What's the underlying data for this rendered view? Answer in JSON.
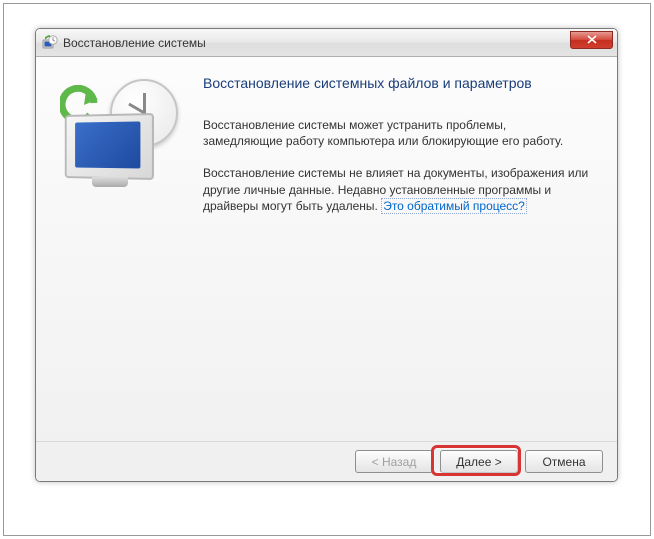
{
  "window": {
    "title": "Восстановление системы"
  },
  "page": {
    "heading": "Восстановление системных файлов и параметров",
    "para1": "Восстановление системы может устранить проблемы, замедляющие работу компьютера или блокирующие его работу.",
    "para2_before": "Восстановление системы не влияет на документы, изображения или другие личные данные. Недавно установленные программы и драйверы могут быть удалены. ",
    "para2_link": "Это обратимый процесс?"
  },
  "buttons": {
    "back": "< Назад",
    "next": "Далее >",
    "cancel": "Отмена"
  },
  "icons": {
    "app": "system-restore-icon",
    "close": "close-icon"
  }
}
